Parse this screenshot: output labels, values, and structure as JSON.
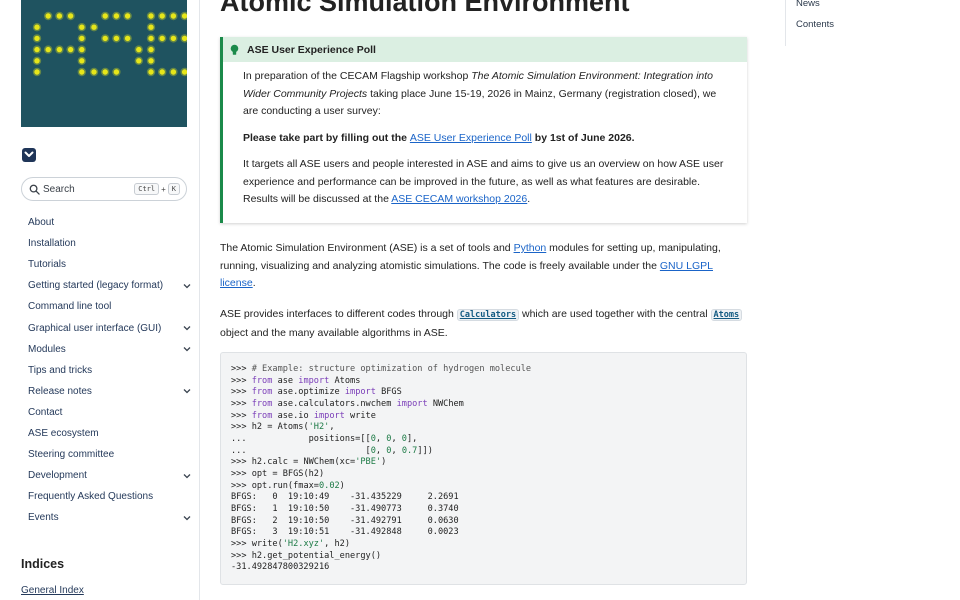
{
  "page": {
    "title": "Atomic Simulation Environment"
  },
  "sidebar": {
    "logo_text": "ASE",
    "search": {
      "label": "Search",
      "kbd1": "Ctrl",
      "kbd_plus": "+",
      "kbd2": "K"
    },
    "nav": [
      {
        "label": "About",
        "expandable": false
      },
      {
        "label": "Installation",
        "expandable": false
      },
      {
        "label": "Tutorials",
        "expandable": false
      },
      {
        "label": "Getting started (legacy format)",
        "expandable": true
      },
      {
        "label": "Command line tool",
        "expandable": false
      },
      {
        "label": "Graphical user interface (GUI)",
        "expandable": true
      },
      {
        "label": "Modules",
        "expandable": true
      },
      {
        "label": "Tips and tricks",
        "expandable": false
      },
      {
        "label": "Release notes",
        "expandable": true
      },
      {
        "label": "Contact",
        "expandable": false
      },
      {
        "label": "ASE ecosystem",
        "expandable": false
      },
      {
        "label": "Steering committee",
        "expandable": false
      },
      {
        "label": "Development",
        "expandable": true
      },
      {
        "label": "Frequently Asked Questions",
        "expandable": false
      },
      {
        "label": "Events",
        "expandable": true
      }
    ],
    "indices_title": "Indices",
    "general_index": "General Index"
  },
  "toc": {
    "items": [
      "News",
      "Contents"
    ]
  },
  "poll": {
    "title": "ASE User Experience Poll",
    "p1_a": "In preparation of the CECAM Flagship workshop ",
    "p1_em": "The Atomic Simulation Environment: Integration into Wider Community Projects",
    "p1_b": " taking place June 15-19, 2026 in Mainz, Germany (registration closed), we are conducting a user survey:",
    "p2_a": "Please take part by filling out the ",
    "p2_link": "ASE User Experience Poll",
    "p2_b": " by 1st of June 2026.",
    "p3_a": "It targets all ASE users and people interested in ASE and aims to give us an overview on how ASE user experience and performance can be improved in the future, as well as what features are desirable. Results will be discussed at the ",
    "p3_link": "ASE CECAM workshop 2026",
    "p3_b": "."
  },
  "intro": {
    "a": "The Atomic Simulation Environment (ASE) is a set of tools and ",
    "python": "Python",
    "b": " modules for setting up, manipulating, running, visualizing and analyzing atomistic simulations. The code is freely available under the ",
    "license": "GNU LGPL license",
    "c": "."
  },
  "interfaces": {
    "a": "ASE provides interfaces to different codes through ",
    "calculators": "Calculators",
    "b": " which are used together with the central ",
    "atoms": "Atoms",
    "c": " object and the many available algorithms in ASE."
  },
  "code": {
    "l1_p": ">>> ",
    "l1_c": "# Example: structure optimization of hydrogen molecule",
    "l2_p": ">>> ",
    "l2_k1": "from",
    "l2_m": " ase ",
    "l2_k2": "import",
    "l2_n": " Atoms",
    "l3_p": ">>> ",
    "l3_k1": "from",
    "l3_m": " ase.optimize ",
    "l3_k2": "import",
    "l3_n": " BFGS",
    "l4_p": ">>> ",
    "l4_k1": "from",
    "l4_m": " ase.calculators.nwchem ",
    "l4_k2": "import",
    "l4_n": " NWChem",
    "l5_p": ">>> ",
    "l5_k1": "from",
    "l5_m": " ase.io ",
    "l5_k2": "import",
    "l5_n": " write",
    "l6_p": ">>> ",
    "l6_a": "h2 = Atoms(",
    "l6_s": "'H2'",
    "l6_b": ",",
    "l7_p": "...            ",
    "l7_a": "positions=[[",
    "l7_n1": "0",
    "l7_c1": ", ",
    "l7_n2": "0",
    "l7_c2": ", ",
    "l7_n3": "0",
    "l7_b": "],",
    "l8_p": "...                       ",
    "l8_a": "[",
    "l8_n1": "0",
    "l8_c1": ", ",
    "l8_n2": "0",
    "l8_c2": ", ",
    "l8_n3": "0.7",
    "l8_b": "]])",
    "l9_p": ">>> ",
    "l9_a": "h2.calc = NWChem(xc=",
    "l9_s": "'PBE'",
    "l9_b": ")",
    "l10_p": ">>> ",
    "l10_a": "opt = BFGS(h2)",
    "l11_p": ">>> ",
    "l11_a": "opt.run(fmax=",
    "l11_n": "0.02",
    "l11_b": ")",
    "l12": "BFGS:   0  19:10:49    -31.435229     2.2691",
    "l13": "BFGS:   1  19:10:50    -31.490773     0.3740",
    "l14": "BFGS:   2  19:10:50    -31.492791     0.0630",
    "l15": "BFGS:   3  19:10:51    -31.492848     0.0023",
    "l16_p": ">>> ",
    "l16_a": "write(",
    "l16_s": "'H2.xyz'",
    "l16_b": ", h2)",
    "l17_p": ">>> ",
    "l17_a": "h2.get_potential_energy()",
    "l18": "-31.492847800329216"
  },
  "colors": {
    "accent_green": "#1b8a4a",
    "link_blue": "#1a64c8",
    "logo_bg": "#1f5360",
    "logo_dot": "#e6e61a"
  }
}
